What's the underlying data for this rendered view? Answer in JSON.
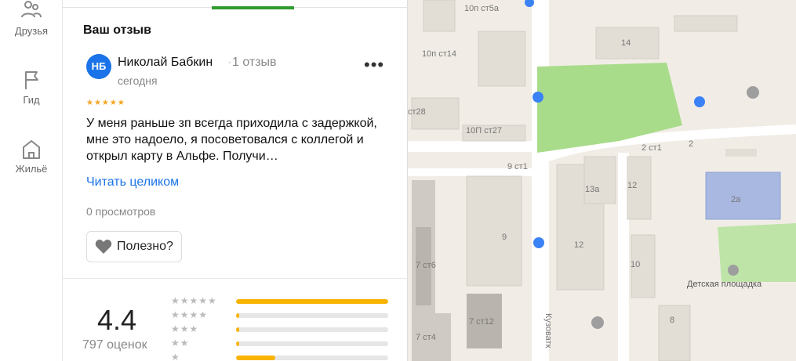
{
  "nav": {
    "items": [
      {
        "label": "Друзья",
        "icon": "friends-icon"
      },
      {
        "label": "Гид",
        "icon": "flag-icon"
      },
      {
        "label": "Жильё",
        "icon": "house-icon"
      }
    ]
  },
  "review": {
    "section_title": "Ваш отзыв",
    "avatar_initials": "НБ",
    "author": "Николай Бабкин",
    "author_reviews": "1 отзыв",
    "date": "сегодня",
    "stars": 5,
    "text": "У меня раньше зп всегда приходила с задержкой, мне это надоело, я посоветовался с коллегой и открыл карту в Альфе. Получи…",
    "read_more": "Читать целиком",
    "views": "0 просмотров",
    "useful_label": "Полезно?"
  },
  "summary": {
    "rating": "4.4",
    "count_label": "797 оценок",
    "distribution": [
      {
        "stars": 5,
        "fraction": 1.0
      },
      {
        "stars": 4,
        "fraction": 0.02
      },
      {
        "stars": 3,
        "fraction": 0.02
      },
      {
        "stars": 2,
        "fraction": 0.02
      },
      {
        "stars": 1,
        "fraction": 0.26
      }
    ]
  },
  "map": {
    "labels": [
      "10п ст5а",
      "14",
      "10п ст14",
      "ст28",
      "10П ст27",
      "9 ст1",
      "2 ст1",
      "2",
      "13а",
      "12",
      "2а",
      "9",
      "12",
      "10",
      "Детская площадка",
      "7 ст6",
      "7 ст12",
      "7 ст4",
      "Кузоватк",
      "8"
    ]
  },
  "colors": {
    "accent": "#1a73e8",
    "tab": "#2e9b2e",
    "star": "#f8b400",
    "park": "#a8dc8a"
  }
}
